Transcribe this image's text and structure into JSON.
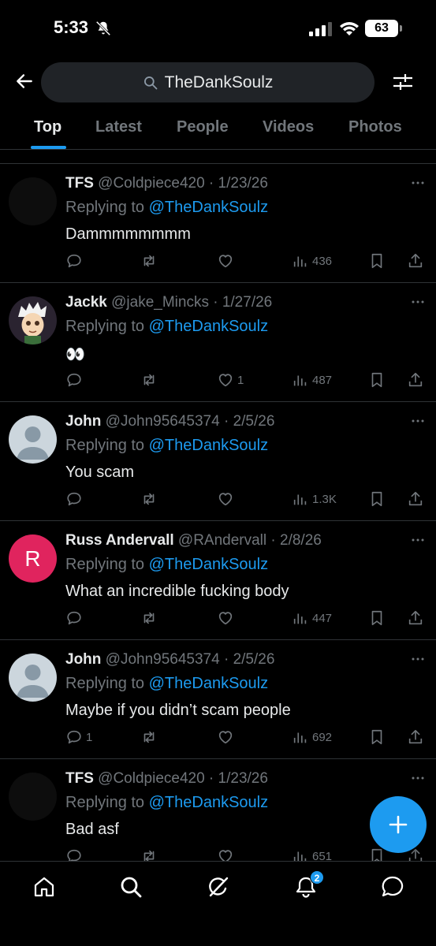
{
  "status_bar": {
    "time": "5:33",
    "battery": "63"
  },
  "header": {
    "search_query": "TheDankSoulz"
  },
  "tabs": [
    {
      "label": "Top",
      "active": true
    },
    {
      "label": "Latest",
      "active": false
    },
    {
      "label": "People",
      "active": false
    },
    {
      "label": "Videos",
      "active": false
    },
    {
      "label": "Photos",
      "active": false
    }
  ],
  "reply_prefix": "Replying to",
  "tweets": [
    {
      "name": "TFS",
      "meta": "@Coldpiece420 · 1/23/26",
      "reply_to": "@TheDankSoulz",
      "text": "Dammmmmmmm",
      "replies": "",
      "likes": "",
      "views": "436",
      "avatar": "dark"
    },
    {
      "name": "Jackk",
      "meta": "@jake_Mincks · 1/27/26",
      "reply_to": "@TheDankSoulz",
      "text": "👀",
      "replies": "",
      "likes": "1",
      "views": "487",
      "avatar": "cartoon"
    },
    {
      "name": "John",
      "meta": "@John95645374 · 2/5/26",
      "reply_to": "@TheDankSoulz",
      "text": "You scam",
      "replies": "",
      "likes": "",
      "views": "1.3K",
      "avatar": "default"
    },
    {
      "name": "Russ Andervall",
      "meta": "@RAndervall · 2/8/26",
      "reply_to": "@TheDankSoulz",
      "text": "What an incredible fucking body",
      "replies": "",
      "likes": "",
      "views": "447",
      "avatar": "letter",
      "avatar_letter": "R"
    },
    {
      "name": "John",
      "meta": "@John95645374 · 2/5/26",
      "reply_to": "@TheDankSoulz",
      "text": "Maybe if you didn’t scam people",
      "replies": "1",
      "likes": "",
      "views": "692",
      "avatar": "default"
    },
    {
      "name": "TFS",
      "meta": "@Coldpiece420 · 1/23/26",
      "reply_to": "@TheDankSoulz",
      "text": "Bad asf",
      "replies": "",
      "likes": "",
      "views": "651",
      "avatar": "dark"
    }
  ],
  "bottom_nav": {
    "notifications_badge": "2"
  },
  "colors": {
    "accent": "#1d9bf0",
    "background": "#000000",
    "muted": "#71767b",
    "text": "#e7e9ea"
  }
}
